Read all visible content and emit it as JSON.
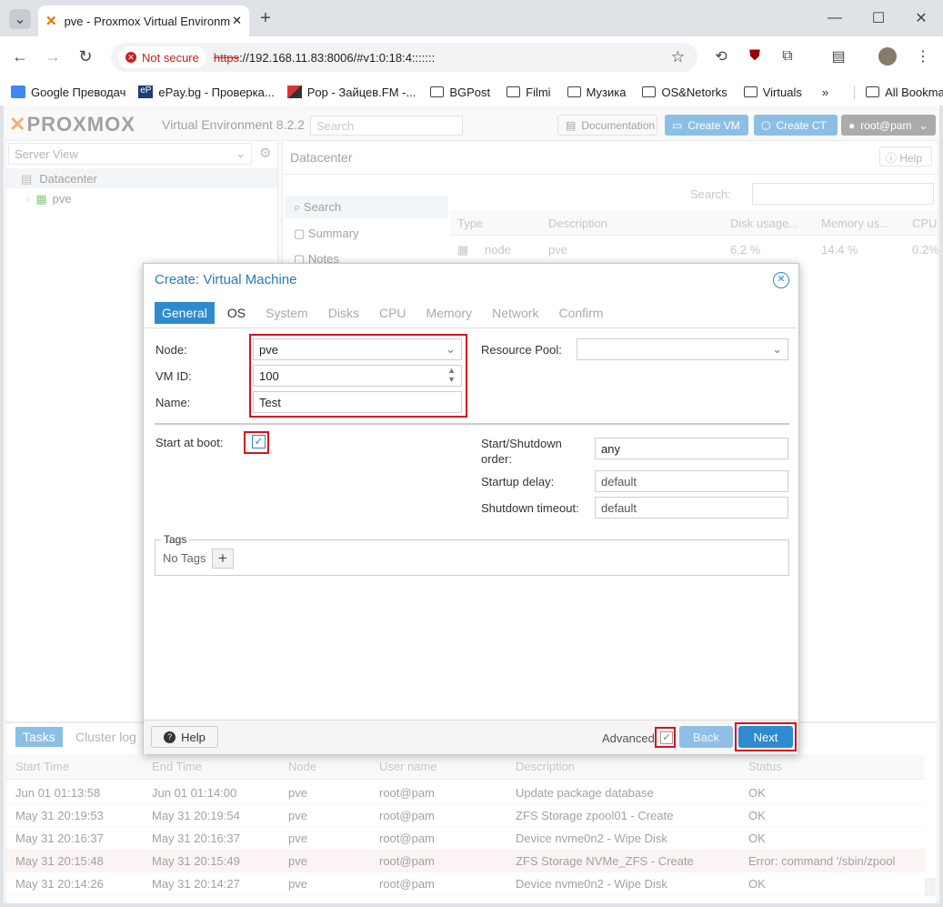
{
  "browser": {
    "tab_title": "pve - Proxmox Virtual Environm",
    "security_label": "Not secure",
    "url_scheme": "https",
    "url_rest": "://192.168.11.83:8006/#v1:0:18:4:::::::",
    "bookmarks": [
      "Google Преводач",
      "ePay.bg - Проверка...",
      "Pop - Зайцев.FM -...",
      "BGPost",
      "Filmi",
      "Музика",
      "OS&Netorks",
      "Virtuals"
    ],
    "all_bookmarks": "All Bookmarks",
    "overflow": "»"
  },
  "header": {
    "logo": "PROXMOX",
    "product": "Virtual Environment 8.2.2",
    "search_placeholder": "Search",
    "documentation": "Documentation",
    "create_vm": "Create VM",
    "create_ct": "Create CT",
    "user": "root@pam"
  },
  "tree": {
    "view": "Server View",
    "datacenter": "Datacenter",
    "node": "pve"
  },
  "center": {
    "title": "Datacenter",
    "help": "Help",
    "nav": [
      "Search",
      "Summary",
      "Notes"
    ],
    "search_label": "Search:",
    "columns": [
      "Type",
      "Description",
      "Disk usage...",
      "Memory us...",
      "CPU"
    ],
    "row": {
      "type": "node",
      "description": "pve",
      "disk": "6.2 %",
      "memory": "14.4 %",
      "cpu": "0.2%"
    }
  },
  "tasks": {
    "tabs": [
      "Tasks",
      "Cluster log"
    ],
    "columns": [
      "Start Time",
      "End Time",
      "Node",
      "User name",
      "Description",
      "Status"
    ],
    "rows": [
      {
        "start": "Jun 01 01:13:58",
        "end": "Jun 01 01:14:00",
        "node": "pve",
        "user": "root@pam",
        "desc": "Update package database",
        "status": "OK"
      },
      {
        "start": "May 31 20:19:53",
        "end": "May 31 20:19:54",
        "node": "pve",
        "user": "root@pam",
        "desc": "ZFS Storage zpool01 - Create",
        "status": "OK"
      },
      {
        "start": "May 31 20:16:37",
        "end": "May 31 20:16:37",
        "node": "pve",
        "user": "root@pam",
        "desc": "Device nvme0n2 - Wipe Disk",
        "status": "OK"
      },
      {
        "start": "May 31 20:15:48",
        "end": "May 31 20:15:49",
        "node": "pve",
        "user": "root@pam",
        "desc": "ZFS Storage NVMe_ZFS - Create",
        "status": "Error: command '/sbin/zpool"
      },
      {
        "start": "May 31 20:14:26",
        "end": "May 31 20:14:27",
        "node": "pve",
        "user": "root@pam",
        "desc": "Device nvme0n2 - Wipe Disk",
        "status": "OK"
      }
    ]
  },
  "dialog": {
    "title": "Create: Virtual Machine",
    "tabs": [
      "General",
      "OS",
      "System",
      "Disks",
      "CPU",
      "Memory",
      "Network",
      "Confirm"
    ],
    "node_label": "Node:",
    "node_value": "pve",
    "vmid_label": "VM ID:",
    "vmid_value": "100",
    "name_label": "Name:",
    "name_value": "Test",
    "pool_label": "Resource Pool:",
    "pool_value": "",
    "boot_label": "Start at boot:",
    "order_label_1": "Start/Shutdown",
    "order_label_2": "order:",
    "order_value": "any",
    "delay_label": "Startup delay:",
    "delay_value": "default",
    "timeout_label": "Shutdown timeout:",
    "timeout_value": "default",
    "tags_legend": "Tags",
    "tags_value": "No Tags",
    "help": "Help",
    "advanced": "Advanced",
    "back": "Back",
    "next": "Next"
  },
  "colors": {
    "accent": "#2e8bd0",
    "highlight": "#d6121f",
    "error_row": "#f9e9ea"
  }
}
